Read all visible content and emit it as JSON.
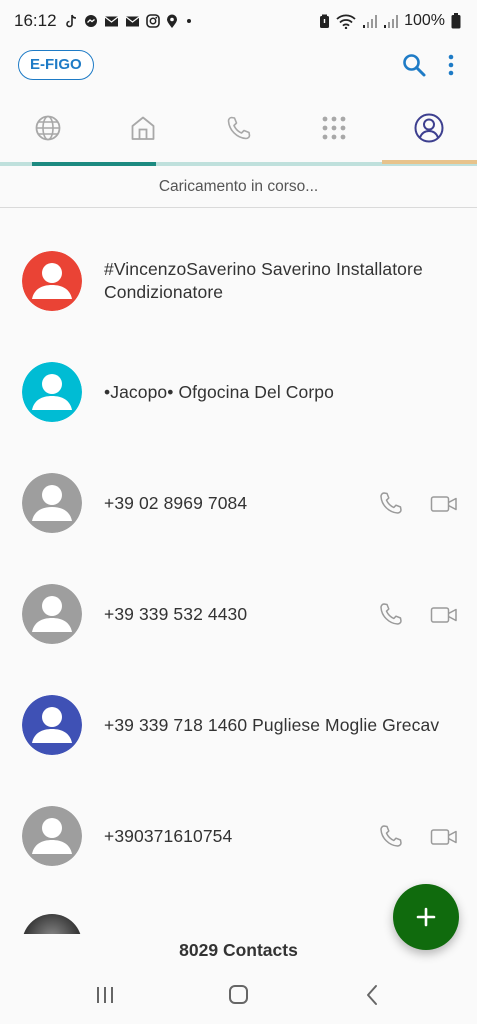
{
  "status_bar": {
    "time": "16:12",
    "battery": "100%",
    "left_icons": [
      "tiktok-icon",
      "messenger-icon",
      "mail-icon",
      "mail-icon",
      "instagram-icon",
      "location-icon",
      "dot-icon"
    ],
    "right_icons": [
      "alarm-icon",
      "wifi-icon",
      "signal-icon",
      "signal-icon",
      "battery-icon"
    ]
  },
  "app_bar": {
    "brand": "E-FIGO",
    "actions": [
      "search-icon",
      "more-vert-icon"
    ],
    "accent_color": "#1e7bc6"
  },
  "tabs": [
    {
      "icon": "globe-icon",
      "active": false
    },
    {
      "icon": "home-icon",
      "active": false
    },
    {
      "icon": "phone-icon",
      "active": false
    },
    {
      "icon": "dialpad-icon",
      "active": false
    },
    {
      "icon": "profile-icon",
      "active": true
    }
  ],
  "loading_text": "Caricamento in corso...",
  "contacts": [
    {
      "name": "#VincenzoSaverino Saverino Installatore Condizionatore",
      "avatar_color": "#ea4335",
      "has_actions": false
    },
    {
      "name": "•Jacopo• Ofgocina Del Corpo",
      "avatar_color": "#00bcd4",
      "has_actions": false
    },
    {
      "name": "+39 02 8969 7084",
      "avatar_color": "#9e9e9e",
      "has_actions": true
    },
    {
      "name": "+39 339 532 4430",
      "avatar_color": "#9e9e9e",
      "has_actions": true
    },
    {
      "name": "+39 339 718 1460 Pugliese Moglie Grecav",
      "avatar_color": "#3f51b5",
      "has_actions": false
    },
    {
      "name": "+390371610754",
      "avatar_color": "#9e9e9e",
      "has_actions": true
    }
  ],
  "contacts_count": "8029 Contacts",
  "fab": {
    "icon": "plus-icon",
    "label": "+",
    "color": "#106b0d"
  },
  "nav_bar": {
    "items": [
      "recent-apps-icon",
      "home-button-icon",
      "back-icon"
    ]
  }
}
